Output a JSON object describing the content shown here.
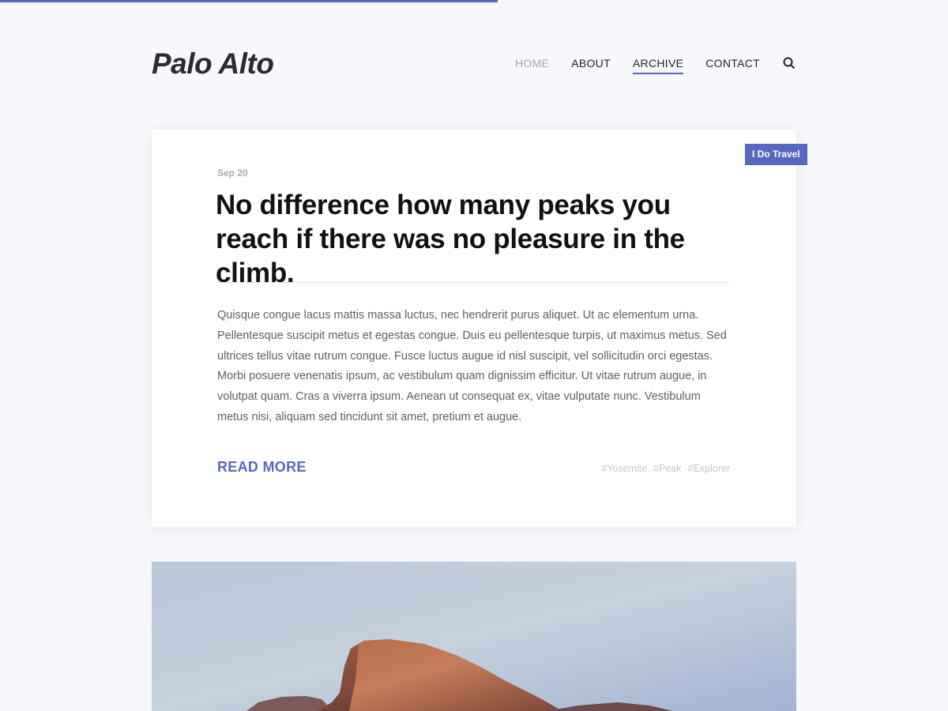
{
  "progress": {
    "fraction": 0.525,
    "color": "#5867c0"
  },
  "site": {
    "title": "Palo Alto"
  },
  "nav": {
    "items": [
      {
        "label": "HOME",
        "state": "muted"
      },
      {
        "label": "ABOUT",
        "state": "normal"
      },
      {
        "label": "ARCHIVE",
        "state": "active"
      },
      {
        "label": "CONTACT",
        "state": "normal"
      }
    ],
    "search_icon": "search-icon"
  },
  "post": {
    "category": "I Do Travel",
    "date": "Sep 20",
    "title": "No difference how many peaks you reach if there was no pleasure in the climb.",
    "excerpt": "Quisque congue lacus mattis massa luctus, nec hendrerit purus aliquet. Ut ac elementum urna. Pellentesque suscipit metus et egestas congue. Duis eu pellentesque turpis, ut maximus metus. Sed ultrices tellus vitae rutrum congue. Fusce luctus augue id nisl suscipit, vel sollicitudin orci egestas. Morbi posuere venenatis ipsum, ac vestibulum quam dignissim efficitur. Ut vitae rutrum augue, in volutpat quam. Cras a viverra ipsum. Aenean ut consequat ex, vitae vulputate nunc. Vestibulum metus nisi, aliquam sed tincidunt sit amet, pretium et augue.",
    "read_more": "READ MORE",
    "tags": [
      "#Yosemite",
      "#Peak",
      "#Explorer"
    ]
  },
  "second_post": {
    "image": "mountain-peak-photo"
  },
  "colors": {
    "accent": "#5867c0",
    "background": "#f7f8fc",
    "card": "#ffffff"
  }
}
